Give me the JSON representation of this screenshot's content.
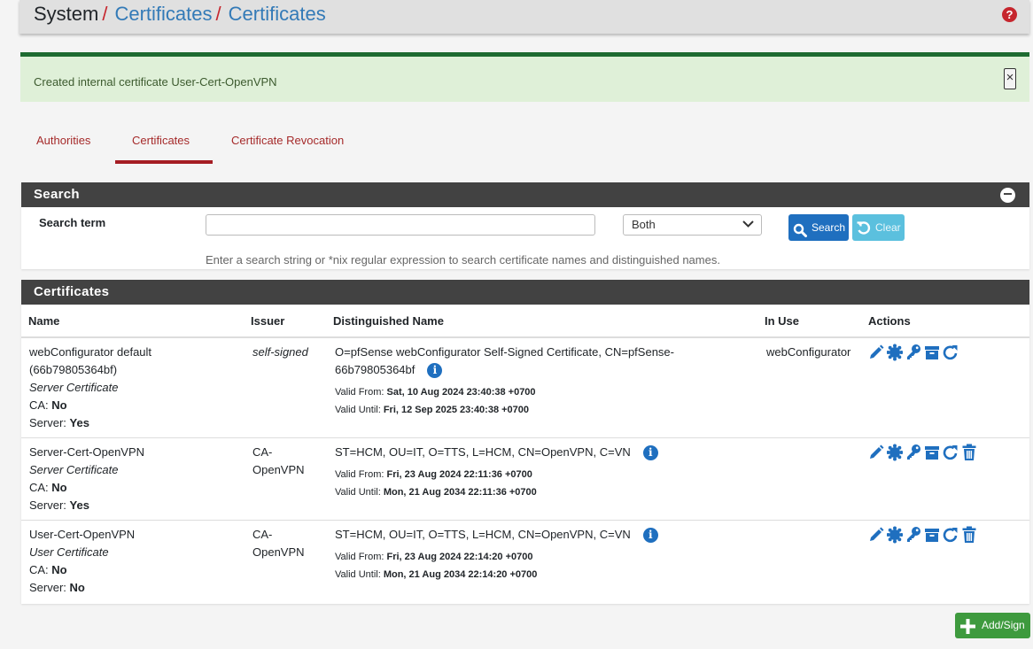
{
  "breadcrumb": {
    "root": "System",
    "sep": "/",
    "level1": "Certificates",
    "level2": "Certificates"
  },
  "help_icon": "?",
  "alert": {
    "message": "Created internal certificate User-Cert-OpenVPN",
    "close": "×"
  },
  "tabs": [
    {
      "label": "Authorities"
    },
    {
      "label": "Certificates",
      "active": true
    },
    {
      "label": "Certificate Revocation"
    }
  ],
  "search": {
    "title": "Search",
    "collapse": "−",
    "label": "Search term",
    "input_value": "",
    "scope_selected": "Both",
    "search_button": "Search",
    "clear_button": "Clear",
    "help_text": "Enter a search string or *nix regular expression to search certificate names and distinguished names."
  },
  "certificates": {
    "title": "Certificates",
    "columns": [
      "Name",
      "Issuer",
      "Distinguished Name",
      "In Use",
      "Actions"
    ],
    "valid_from_label": "Valid From:",
    "valid_until_label": "Valid Until:",
    "ca_label": "CA:",
    "server_label": "Server:",
    "rows": [
      {
        "name1": "webConfigurator default",
        "name2": "(66b79805364bf)",
        "type": "Server Certificate",
        "ca": "No",
        "server": "Yes",
        "issuer1": "self-signed",
        "issuer2": "",
        "dn1": "O=pfSense webConfigurator Self-Signed Certificate, CN=pfSense-",
        "dn2": "66b79805364bf",
        "valid_from": "Sat, 10 Aug 2024 23:40:38 +0700",
        "valid_until": "Fri, 12 Sep 2025 23:40:38 +0700",
        "in_use": "webConfigurator"
      },
      {
        "name1": "Server-Cert-OpenVPN",
        "type": "Server Certificate",
        "ca": "No",
        "server": "Yes",
        "issuer1": "CA-",
        "issuer2": "OpenVPN",
        "dn1": "ST=HCM, OU=IT, O=TTS, L=HCM, CN=OpenVPN, C=VN",
        "valid_from": "Fri, 23 Aug 2024 22:11:36 +0700",
        "valid_until": "Mon, 21 Aug 2034 22:11:36 +0700",
        "in_use": ""
      },
      {
        "name1": "User-Cert-OpenVPN",
        "type": "User Certificate",
        "ca": "No",
        "server": "No",
        "issuer1": "CA-",
        "issuer2": "OpenVPN",
        "dn1": "ST=HCM, OU=IT, O=TTS, L=HCM, CN=OpenVPN, C=VN",
        "valid_from": "Fri, 23 Aug 2024 22:14:20 +0700",
        "valid_until": "Mon, 21 Aug 2034 22:14:20 +0700",
        "in_use": ""
      }
    ]
  },
  "add_button": "Add/Sign",
  "icons": {
    "edit": "pencil-icon",
    "export_cert": "certificate-icon",
    "export_key": "key-icon",
    "export_p12": "archive-icon",
    "renew": "refresh-icon",
    "delete": "trash-icon",
    "info": "i"
  },
  "colors": {
    "accent_red": "#a51d24",
    "link_blue": "#337ab7",
    "icon_blue": "#1f6fbf",
    "panel_header": "#424242",
    "success_bg": "#dff0d8",
    "add_green": "#3e9a3e",
    "clear_cyan": "#5bc0de"
  }
}
